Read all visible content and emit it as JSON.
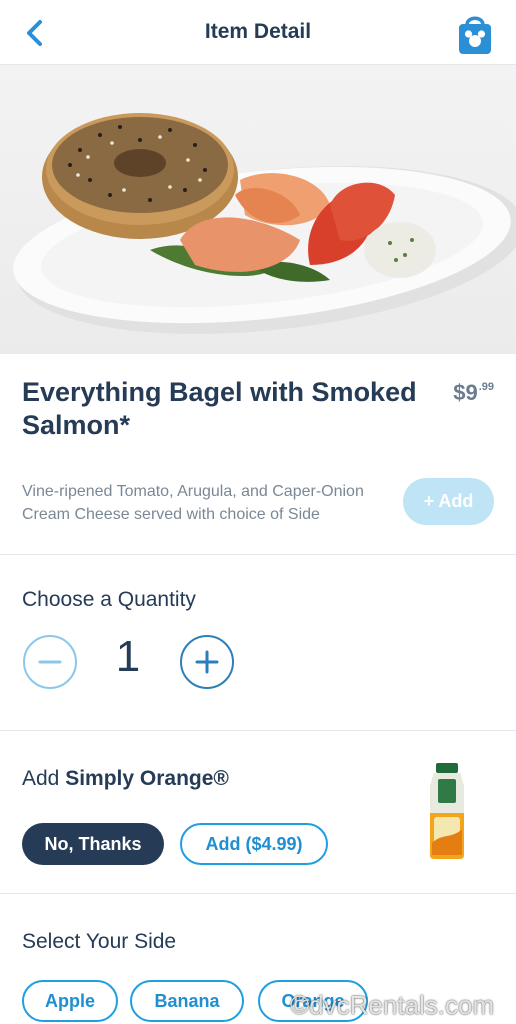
{
  "header": {
    "title": "Item Detail",
    "back_icon": "chevron-left-icon",
    "bag_icon": "shopping-bag-icon"
  },
  "item": {
    "title": "Everything Bagel with Smoked Salmon*",
    "price_dollars": "$9",
    "price_cents": ".99",
    "description": "Vine-ripened Tomato, Arugula, and Caper-Onion Cream Cheese served with choice of Side",
    "add_label": "+ Add"
  },
  "quantity": {
    "label": "Choose a Quantity",
    "value": "1"
  },
  "addon": {
    "prefix": "Add ",
    "product": "Simply Orange®",
    "decline_label": "No, Thanks",
    "add_label": "Add ($4.99)"
  },
  "sides": {
    "label": "Select Your Side",
    "options": [
      "Apple",
      "Banana",
      "Orange"
    ]
  },
  "watermark": "©dvcRentals.com",
  "colors": {
    "primary_text": "#253b56",
    "accent_blue": "#1f9ee0",
    "disabled_add": "#bfe4f6"
  }
}
